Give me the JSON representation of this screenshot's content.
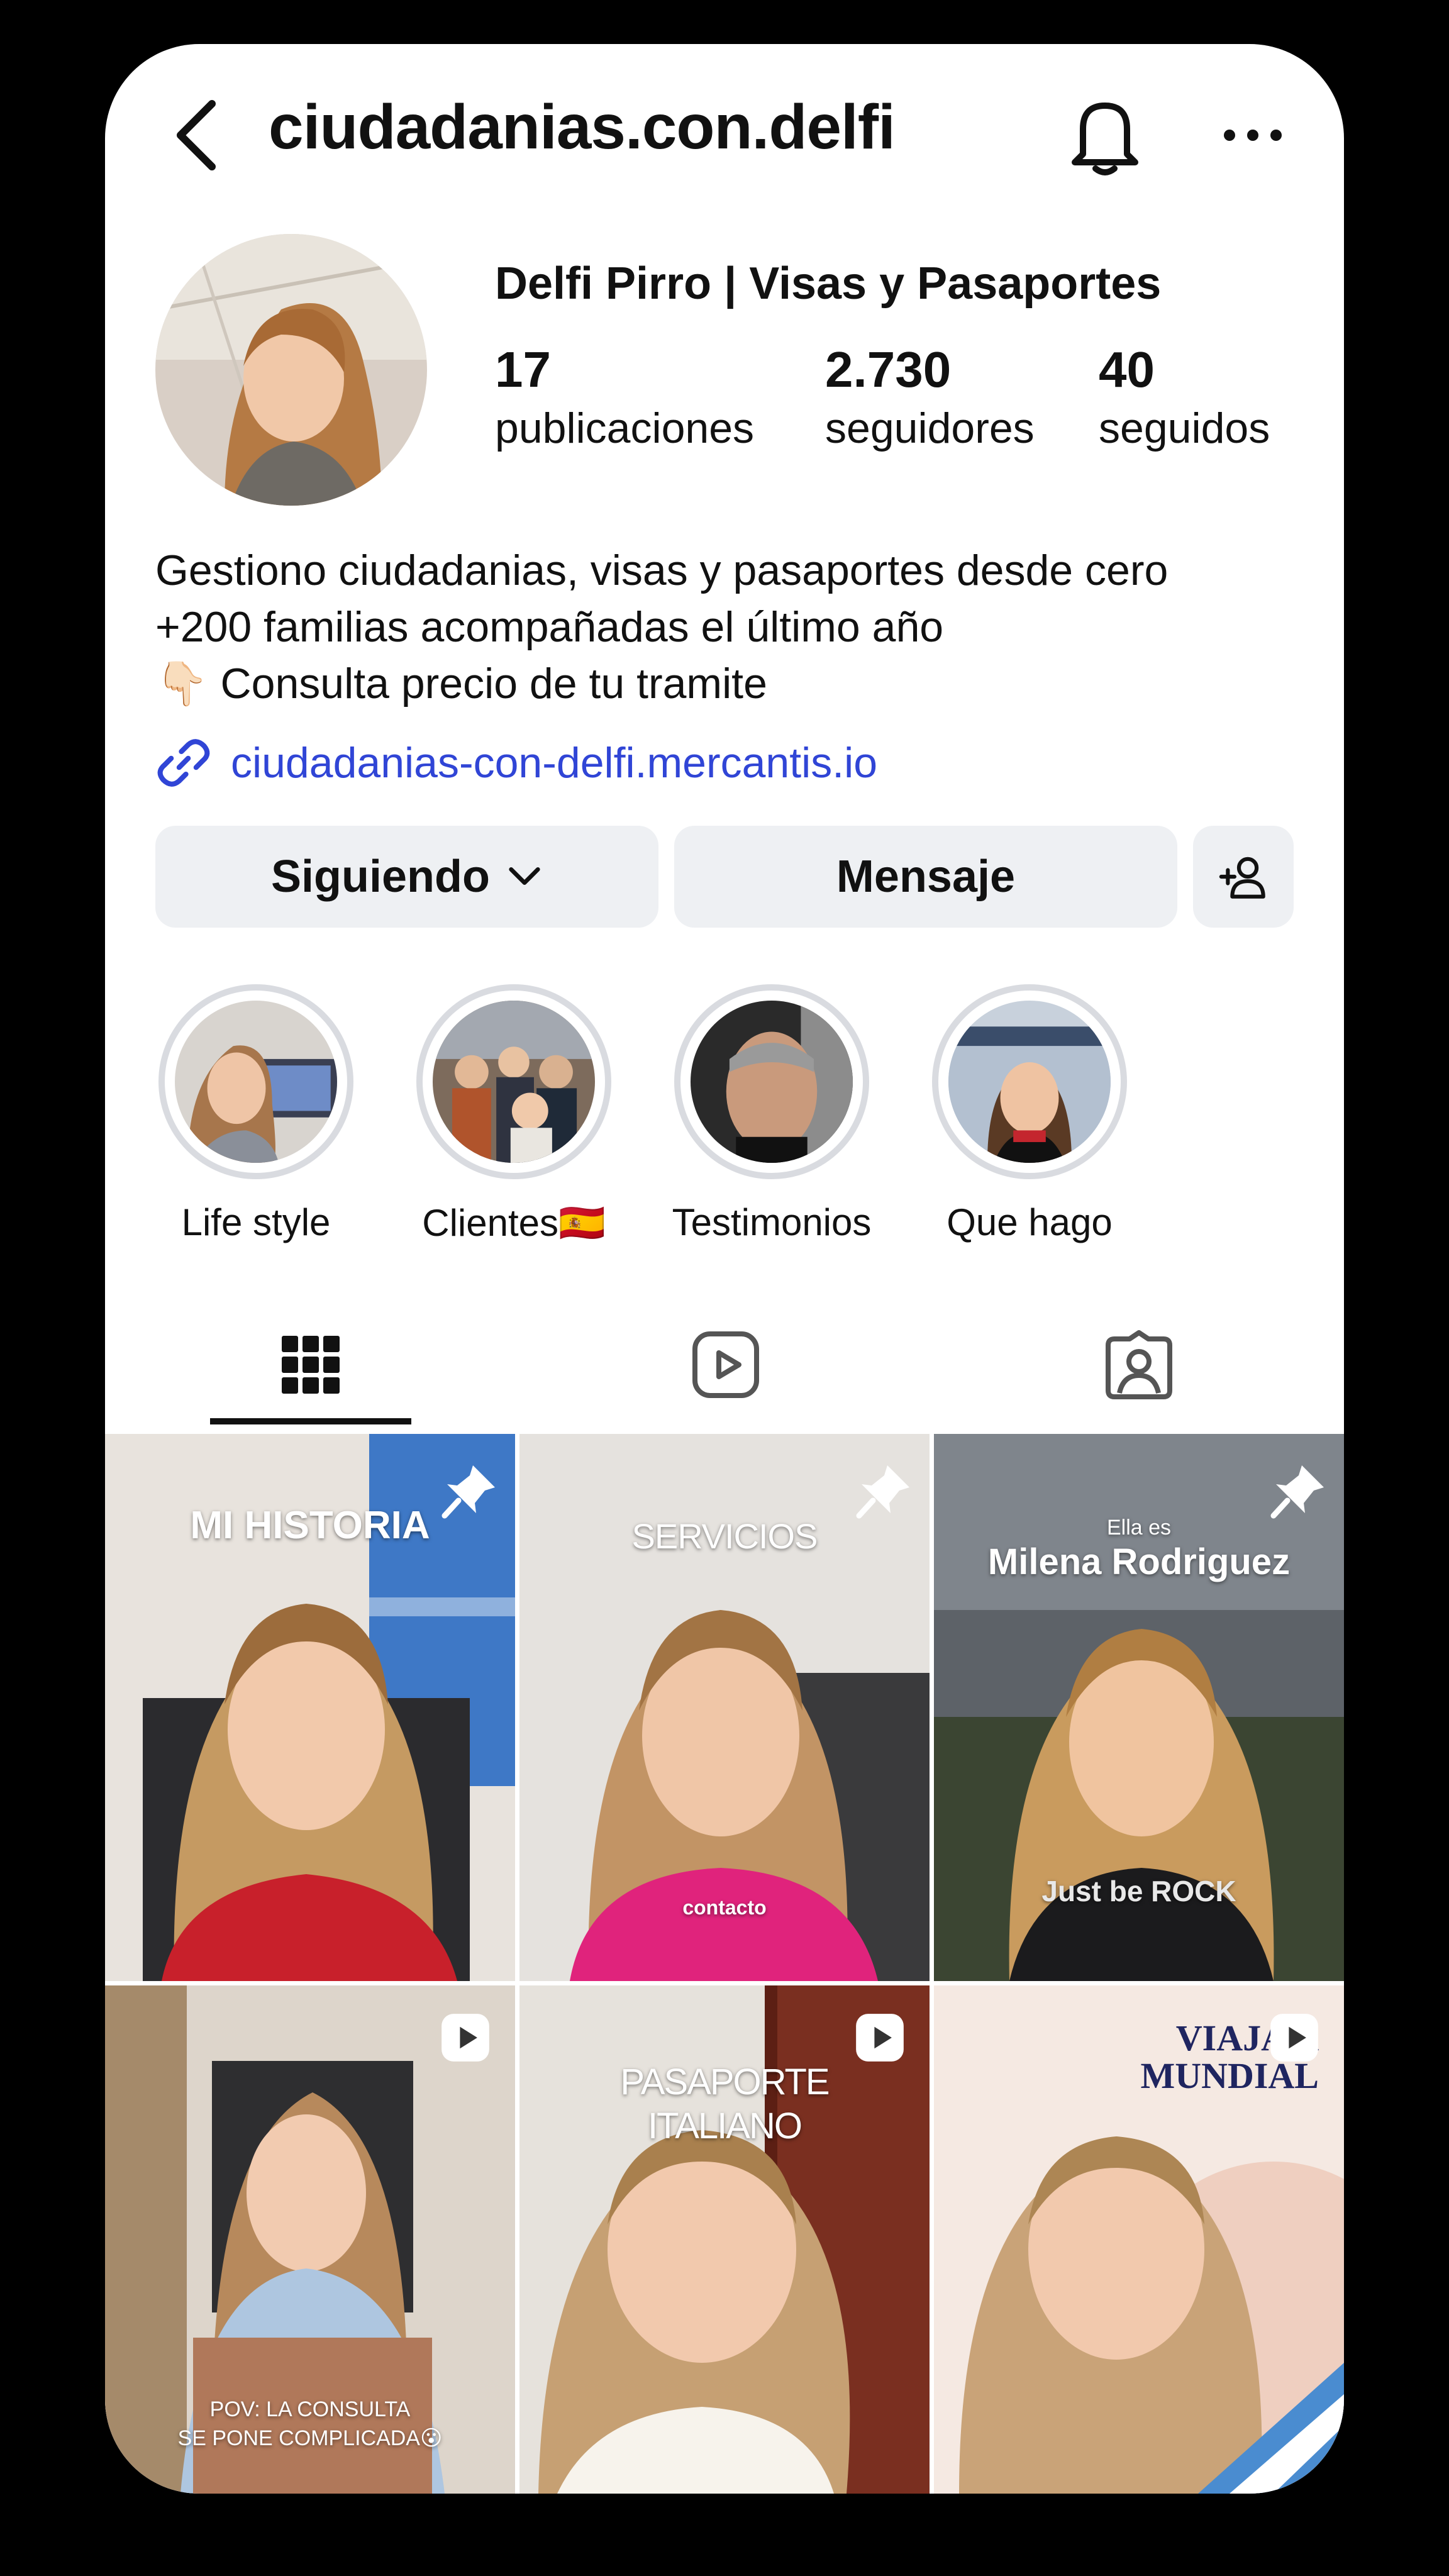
{
  "header": {
    "username": "ciudadanias.con.delfi"
  },
  "profile": {
    "display_name": "Delfi Pirro | Visas y Pasaportes",
    "stats": [
      {
        "value": "17",
        "label": "publicaciones"
      },
      {
        "value": "2.730",
        "label": "seguidores"
      },
      {
        "value": "40",
        "label": "seguidos"
      }
    ],
    "bio": [
      "Gestiono ciudadanias, visas y pasaportes desde cero",
      "+200 familias acompañadas el último año",
      "👇🏻 Consulta precio de tu tramite"
    ],
    "link": "ciudadanias-con-delfi.mercantis.io"
  },
  "actions": {
    "following_label": "Siguiendo",
    "message_label": "Mensaje"
  },
  "highlights": [
    {
      "label": "Life style"
    },
    {
      "label": "Clientes🇪🇸"
    },
    {
      "label": "Testimonios"
    },
    {
      "label": "Que hago"
    }
  ],
  "tabs": [
    "grid-icon",
    "reels-icon",
    "tagged-icon"
  ],
  "posts": [
    {
      "caption": "MI HISTORIA",
      "pinned": true
    },
    {
      "caption": "SERVICIOS",
      "subcaption": "contacto",
      "pinned": true
    },
    {
      "caption_small": "Ella es",
      "caption": "Milena Rodriguez",
      "overlay": "Just be ROCK",
      "pinned": true
    },
    {
      "caption": "POV: LA CONSULTA",
      "caption2": "SE PONE COMPLICADA😮",
      "reel": true
    },
    {
      "caption": "PASAPORTE",
      "caption2": "ITALIANO",
      "reel": true
    },
    {
      "caption": "VIAJA A",
      "caption2": "MUNDIAL",
      "reel": true
    }
  ],
  "colors": {
    "link": "#3045d6",
    "button_bg": "#eef0f3",
    "ring": "#d9dbe0"
  }
}
